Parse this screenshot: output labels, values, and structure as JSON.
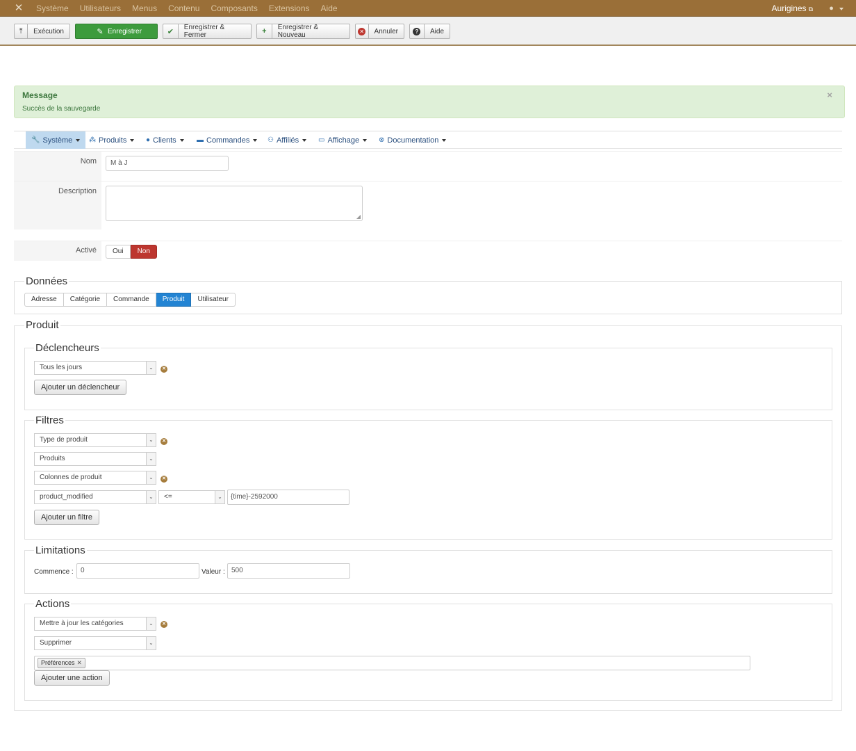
{
  "topbar": {
    "menu": [
      "Système",
      "Utilisateurs",
      "Menus",
      "Contenu",
      "Composants",
      "Extensions",
      "Aide"
    ],
    "site_name": "Aurigines",
    "user_icon": "user-icon"
  },
  "toolbar": {
    "execute": "Exécution",
    "save": "Enregistrer",
    "save_close": "Enregistrer & Fermer",
    "save_new": "Enregistrer & Nouveau",
    "cancel": "Annuler",
    "help": "Aide"
  },
  "message": {
    "heading": "Message",
    "text": "Succès de la sauvegarde",
    "close": "×"
  },
  "hikamenu": {
    "items": [
      {
        "label": "Système",
        "icon": "wrench-icon"
      },
      {
        "label": "Produits",
        "icon": "cubes-icon"
      },
      {
        "label": "Clients",
        "icon": "user-icon"
      },
      {
        "label": "Commandes",
        "icon": "credit-card-icon"
      },
      {
        "label": "Affiliés",
        "icon": "users-icon"
      },
      {
        "label": "Affichage",
        "icon": "monitor-icon"
      },
      {
        "label": "Documentation",
        "icon": "lifebuoy-icon"
      }
    ]
  },
  "form": {
    "name_label": "Nom",
    "name_value": "M à J",
    "description_label": "Description",
    "description_value": "",
    "active_label": "Activé",
    "yes": "Oui",
    "no": "Non"
  },
  "data_section": {
    "legend": "Données",
    "tabs": [
      "Adresse",
      "Catégorie",
      "Commande",
      "Produit",
      "Utilisateur"
    ],
    "selected": "Produit"
  },
  "product": {
    "legend": "Produit",
    "triggers": {
      "legend": "Déclencheurs",
      "select": "Tous les jours",
      "add_button": "Ajouter un déclencheur"
    },
    "filters": {
      "legend": "Filtres",
      "select1": "Type de produit",
      "select2": "Produits",
      "select3": "Colonnes de produit",
      "column_select": "product_modified",
      "operator_select": "<=",
      "value_input": "{time}-2592000",
      "add_button": "Ajouter un filtre"
    },
    "limits": {
      "legend": "Limitations",
      "start_label": "Commence :",
      "start_value": "0",
      "value_label": "Valeur :",
      "value_value": "500"
    },
    "actions": {
      "legend": "Actions",
      "select1": "Mettre à jour les catégories",
      "select2": "Supprimer",
      "tag": "Préférences",
      "add_button": "Ajouter une action"
    }
  }
}
